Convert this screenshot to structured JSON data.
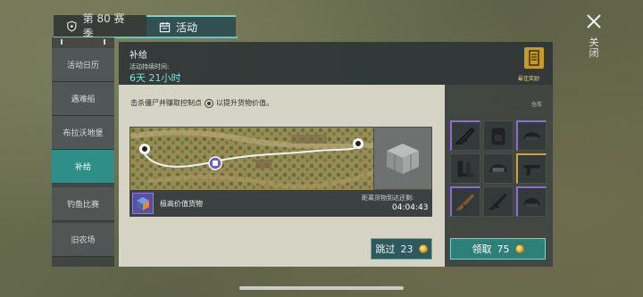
{
  "tabs": [
    {
      "label": "第 80 赛季",
      "icon": "shield-icon",
      "active": false
    },
    {
      "label": "活动",
      "icon": "calendar-icon",
      "active": true
    }
  ],
  "close": {
    "label": "关闭",
    "icon": "close-icon"
  },
  "sidebar": {
    "items": [
      {
        "label": "活动日历"
      },
      {
        "label": "遇难船"
      },
      {
        "label": "布拉沃地堡"
      },
      {
        "label": "补给",
        "active": true
      },
      {
        "label": "钓鱼比赛"
      },
      {
        "label": "旧农场"
      }
    ]
  },
  "main": {
    "title": "补给",
    "duration_label": "活动持续时间:",
    "duration_value": "6天 21小时",
    "description_before": "击杀僵尸并赚取控制点",
    "description_after": "以提升货物价值。",
    "item_name": "极高价值货物",
    "timer_label": "距离货物到达还剩:",
    "timer_value": "04:04:43",
    "skip": {
      "label": "跳过",
      "cost": "23"
    }
  },
  "reward": {
    "best_label": "最佳奖励",
    "warehouse_label": "仓库",
    "slots": [
      {
        "icon": "rifle-icon",
        "rarity": "purple"
      },
      {
        "icon": "backpack-icon",
        "rarity": "none"
      },
      {
        "icon": "helmet-icon",
        "rarity": "purple"
      },
      {
        "icon": "boots-icon",
        "rarity": "none"
      },
      {
        "icon": "helmet-icon",
        "rarity": "none"
      },
      {
        "icon": "pistol-icon",
        "rarity": "gold"
      },
      {
        "icon": "rifle-icon",
        "rarity": "purple"
      },
      {
        "icon": "rifle-icon",
        "rarity": "none"
      },
      {
        "icon": "helmet-icon",
        "rarity": "purple"
      }
    ],
    "claim": {
      "label": "领取",
      "cost": "75"
    }
  },
  "colors": {
    "accent": "#2e8e88",
    "accent_text": "#7fe2d9",
    "rarity_purple": "#8a6fd0",
    "rarity_gold": "#d0a23a",
    "coin": "#d8a529"
  }
}
